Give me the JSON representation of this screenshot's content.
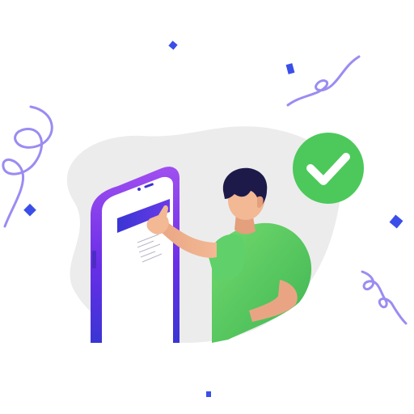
{
  "illustration": {
    "subject": "person-tapping-phone-success",
    "icons": {
      "success": "check-circle-icon",
      "phone": "smartphone-icon",
      "receipt": "receipt-icon"
    },
    "colors": {
      "background": "#ffffff",
      "blob": "#ececec",
      "phone_purple": "#6a2ee8",
      "phone_purple_light": "#9a4df0",
      "phone_blue": "#3a35d4",
      "screen": "#ffffff",
      "banner": "#3d3bd6",
      "shirt": "#5fd06a",
      "shirt_dark": "#3fb553",
      "skin": "#f3b894",
      "skin_shadow": "#e49f7c",
      "hair": "#1d1a4a",
      "check": "#4cc95a",
      "confetti": "#9a8cf2",
      "confetti_blue": "#3a4fe8"
    }
  }
}
